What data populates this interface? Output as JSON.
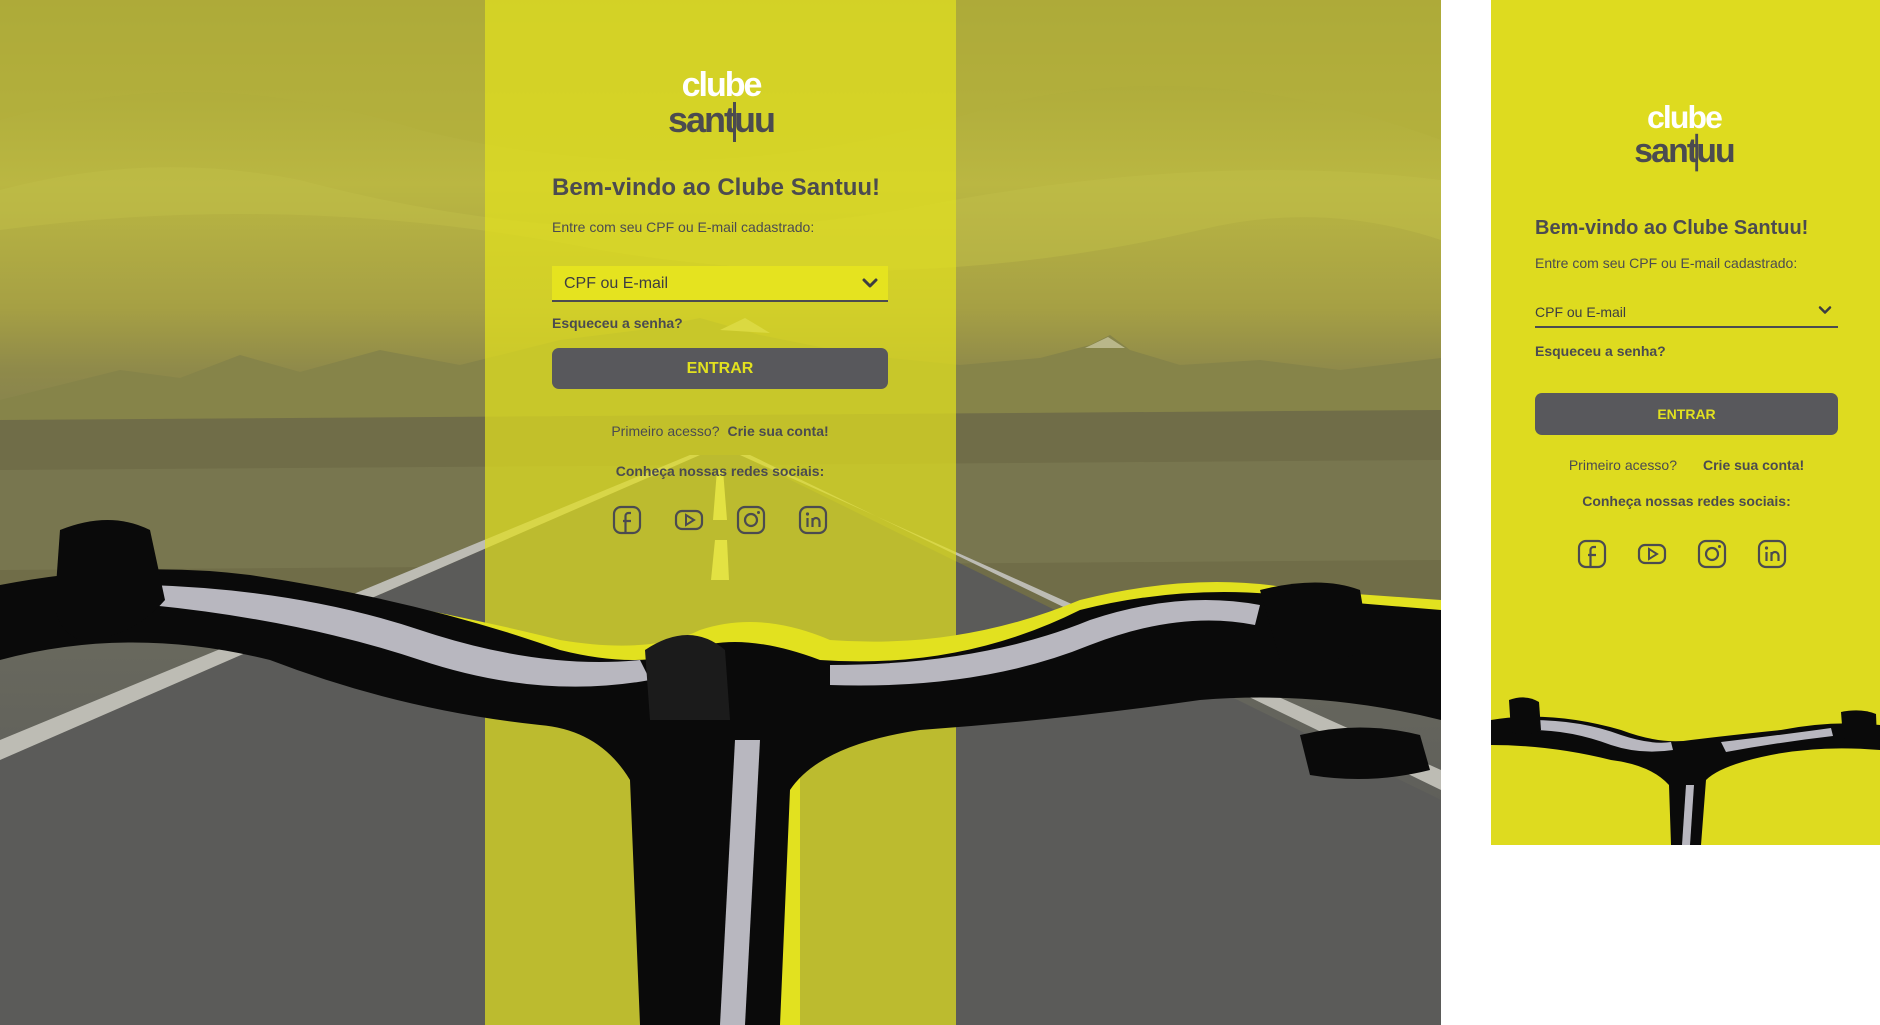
{
  "brand": {
    "logo_line1": "clube",
    "logo_line2": "santuu",
    "accent_color": "#e2e11f",
    "dark_color": "#4b4b50"
  },
  "login": {
    "title": "Bem-vindo ao Clube Santuu!",
    "subtitle": "Entre com seu CPF ou E-mail cadastrado:",
    "identifier_placeholder": "CPF ou E-mail",
    "forgot_password": "Esqueceu a senha?",
    "submit_label": "ENTRAR",
    "first_access_text": "Primeiro acesso?",
    "create_account_link": "Crie sua conta!",
    "social_title": "Conheça nossas redes sociais:",
    "social_icons": [
      "facebook-icon",
      "youtube-icon",
      "instagram-icon",
      "linkedin-icon"
    ]
  }
}
